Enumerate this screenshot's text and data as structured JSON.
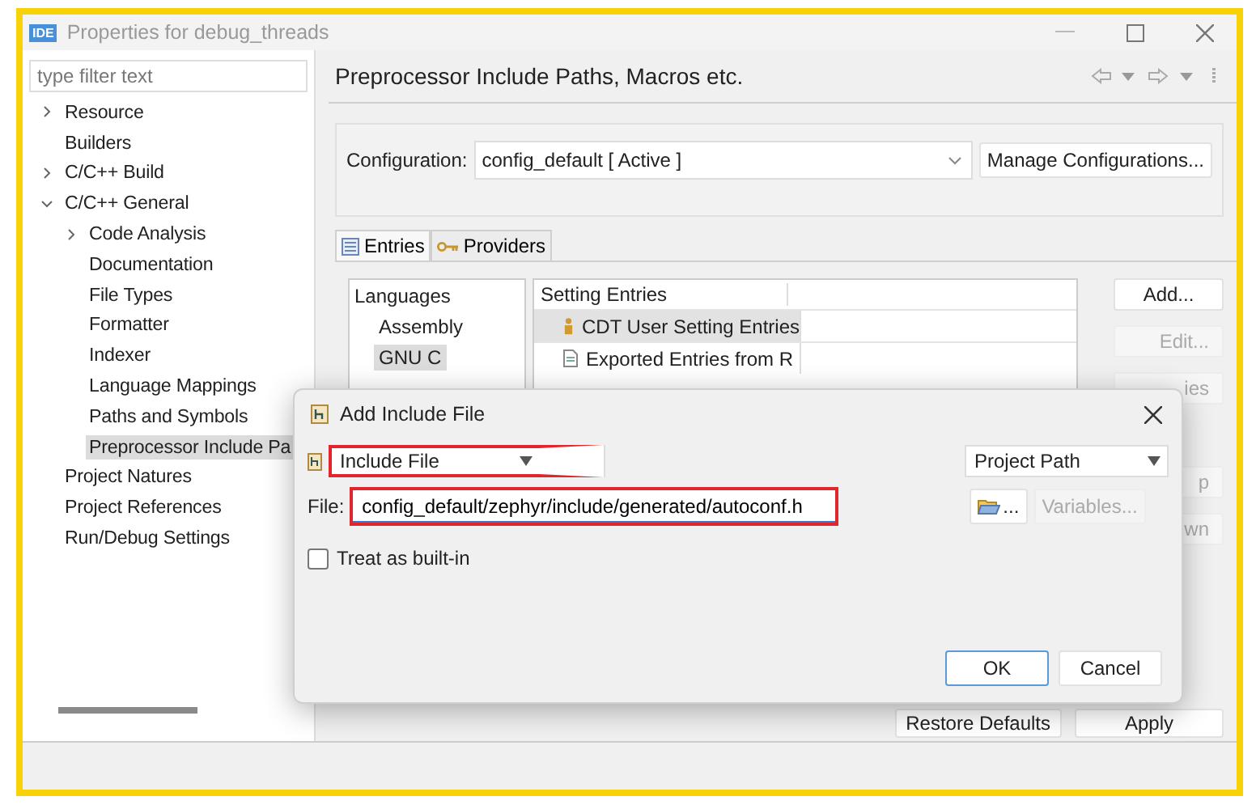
{
  "window": {
    "logo": "IDE",
    "title": "Properties for debug_threads"
  },
  "filter": {
    "placeholder": "type filter text"
  },
  "tree": [
    {
      "label": "Resource",
      "kind": "branch",
      "expanded": false,
      "selected": false
    },
    {
      "label": "Builders",
      "kind": "leaf",
      "selected": false
    },
    {
      "label": "C/C++ Build",
      "kind": "branch",
      "expanded": false,
      "selected": false
    },
    {
      "label": "C/C++ General",
      "kind": "branch",
      "expanded": true,
      "selected": false,
      "children": [
        {
          "label": "Code Analysis",
          "kind": "branch",
          "expanded": false,
          "selected": false
        },
        {
          "label": "Documentation",
          "kind": "leaf",
          "selected": false
        },
        {
          "label": "File Types",
          "kind": "leaf",
          "selected": false
        },
        {
          "label": "Formatter",
          "kind": "leaf",
          "selected": false
        },
        {
          "label": "Indexer",
          "kind": "leaf",
          "selected": false
        },
        {
          "label": "Language Mappings",
          "kind": "leaf",
          "selected": false
        },
        {
          "label": "Paths and Symbols",
          "kind": "leaf",
          "selected": false
        },
        {
          "label": "Preprocessor Include Pa",
          "kind": "leaf",
          "selected": true
        }
      ]
    },
    {
      "label": "Project Natures",
      "kind": "leaf",
      "selected": false
    },
    {
      "label": "Project References",
      "kind": "leaf",
      "selected": false
    },
    {
      "label": "Run/Debug Settings",
      "kind": "leaf",
      "selected": false
    }
  ],
  "page": {
    "title": "Preprocessor Include Paths, Macros etc.",
    "configuration": {
      "label": "Configuration:",
      "value": "config_default  [ Active ]"
    },
    "manage_button": "Manage Configurations...",
    "tabs": [
      {
        "label": "Entries",
        "selected": true
      },
      {
        "label": "Providers",
        "selected": false
      }
    ],
    "languages": {
      "header": "Languages",
      "items": [
        {
          "label": "Assembly",
          "selected": false
        },
        {
          "label": "GNU C",
          "selected": true
        }
      ]
    },
    "entries": {
      "header": "Setting Entries",
      "items": [
        {
          "label": "CDT User Setting Entries",
          "selected": true
        },
        {
          "label": "Exported Entries from R",
          "selected": false
        }
      ]
    },
    "side_buttons": [
      {
        "label": "Add...",
        "disabled": false
      },
      {
        "label": "Edit...",
        "disabled": true
      },
      {
        "label": "ies",
        "disabled": true
      },
      {
        "label": "p",
        "disabled": true
      },
      {
        "label": "wn",
        "disabled": true
      }
    ],
    "restore_button": "Restore Defaults",
    "apply_button": "Apply"
  },
  "dialog": {
    "title": "Add Include File",
    "type_dropdown": {
      "value": "Include File",
      "highlighted": true
    },
    "path_dropdown": {
      "value": "Project Path"
    },
    "file": {
      "label": "File:",
      "value": "config_default/zephyr/include/generated/autoconf.h",
      "highlighted": true
    },
    "browse_button": "...",
    "variables_button": {
      "label": "Variables...",
      "disabled": true
    },
    "builtin": {
      "label": "Treat as built-in",
      "checked": false
    },
    "ok_button": "OK",
    "cancel_button": "Cancel"
  }
}
